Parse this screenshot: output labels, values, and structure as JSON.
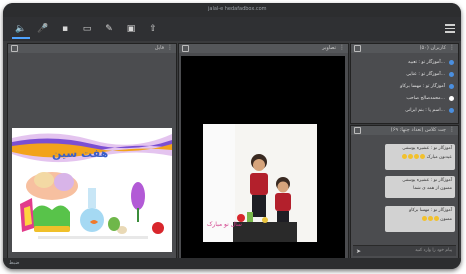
{
  "window": {
    "title": "jalal-e hedafadbox.com"
  },
  "toolbar": {
    "icons": [
      "volume-icon",
      "mic-off-icon",
      "camera-icon",
      "screen-share-icon",
      "pen-icon",
      "whiteboard-icon",
      "upload-icon"
    ],
    "menu_icon": "hamburger-icon"
  },
  "presentation": {
    "title": "فایل",
    "slide": {
      "heading": "هفت سین"
    }
  },
  "video": {
    "title": "تصاویر",
    "caption": "سال نو مبارک"
  },
  "users": {
    "title": "کاربران (۵۰)",
    "items": [
      {
        "name": "آموزگار تو : تعبیه..."
      },
      {
        "name": "آموزگار تو : عنایی..."
      },
      {
        "name": "آموزگار تو : مهسا برکاو"
      },
      {
        "name": "محمدصالح صاحب..."
      },
      {
        "name": "اسم پا : بنم ایرانی..."
      }
    ]
  },
  "chat": {
    "title": "چت کلاس (تعداد چتها: ۶۹)",
    "messages": [
      {
        "sender": "آموزگار تو : عشیره یوسفی",
        "text": "عیدتون مبارک"
      },
      {
        "sender": "آموزگار تو : عشیره یوسفی",
        "text": "ممنون از همه ی شما"
      },
      {
        "sender": "آموزگار تو : مهسا برکاو",
        "text": "ممنون"
      }
    ],
    "input_placeholder": "پیام خود را وارد کنید"
  },
  "footer": {
    "status": "ضبط"
  },
  "colors": {
    "accent": "#4fa3ff",
    "panel": "#4b4c4f",
    "background": "#3a3b3d"
  }
}
